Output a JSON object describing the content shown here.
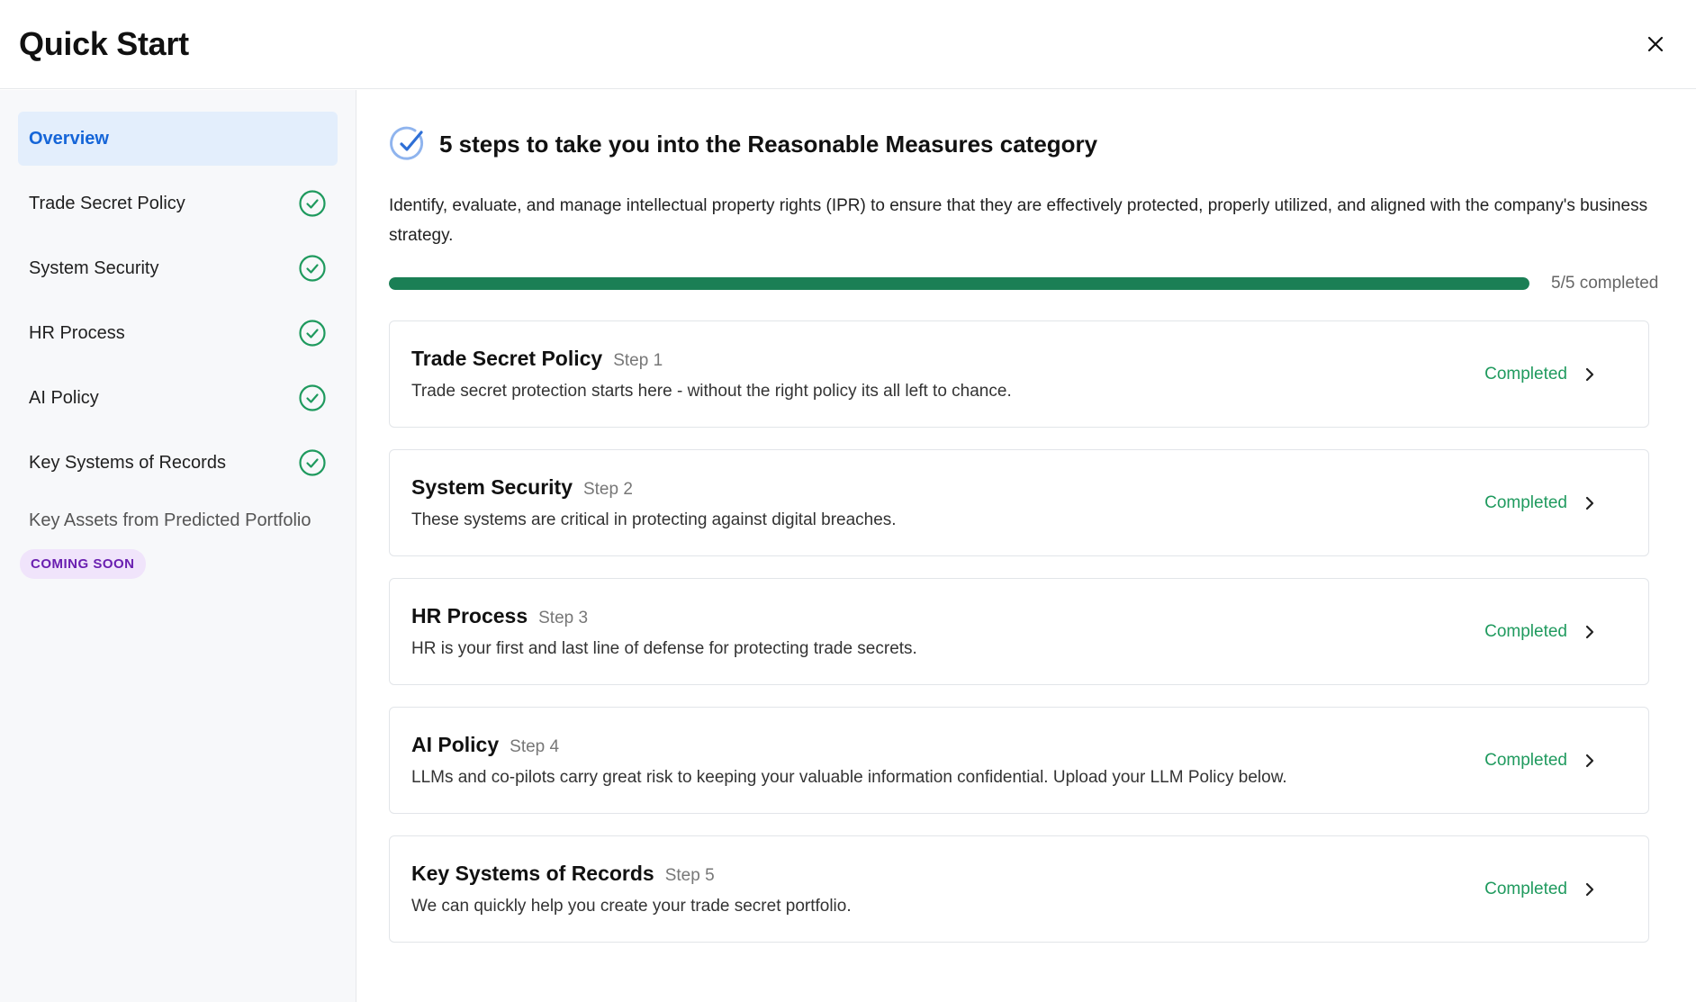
{
  "header": {
    "title": "Quick Start"
  },
  "sidebar": {
    "items": [
      {
        "label": "Overview"
      },
      {
        "label": "Trade Secret Policy"
      },
      {
        "label": "System Security"
      },
      {
        "label": "HR Process"
      },
      {
        "label": "AI Policy"
      },
      {
        "label": "Key Systems of Records"
      }
    ],
    "upcoming": {
      "label": "Key Assets from Predicted Portfolio",
      "badge": "COMING SOON"
    }
  },
  "main": {
    "heading": "5 steps to take you into the Reasonable Measures category",
    "description": "Identify, evaluate, and manage intellectual property rights (IPR) to ensure that they are effectively protected, properly utilized, and aligned with the company's business strategy.",
    "progress": {
      "fraction": 1.0,
      "label": "5/5 completed"
    },
    "steps": [
      {
        "title": "Trade Secret Policy",
        "step": "Step 1",
        "desc": "Trade secret protection starts here - without the right policy its all left to chance.",
        "status": "Completed"
      },
      {
        "title": "System Security",
        "step": "Step 2",
        "desc": "These systems are critical in protecting against digital breaches.",
        "status": "Completed"
      },
      {
        "title": "HR Process",
        "step": "Step 3",
        "desc": "HR is your first and last line of defense for protecting trade secrets.",
        "status": "Completed"
      },
      {
        "title": "AI Policy",
        "step": "Step 4",
        "desc": "LLMs and co-pilots carry great risk to keeping your valuable information confidential. Upload your LLM Policy below.",
        "status": "Completed"
      },
      {
        "title": "Key Systems of Records",
        "step": "Step 5",
        "desc": "We can quickly help you create your trade secret portfolio.",
        "status": "Completed"
      }
    ]
  },
  "colors": {
    "accent": "#1565d8",
    "success": "#1f9a5e",
    "progress": "#1b7f55",
    "badge_bg": "#f0e4fb",
    "badge_text": "#6a1fb0"
  },
  "icons": {
    "close": "close-icon",
    "heading": "check-circle-icon",
    "nav_status": "check-circle-icon",
    "step_arrow": "chevron-right-icon"
  }
}
